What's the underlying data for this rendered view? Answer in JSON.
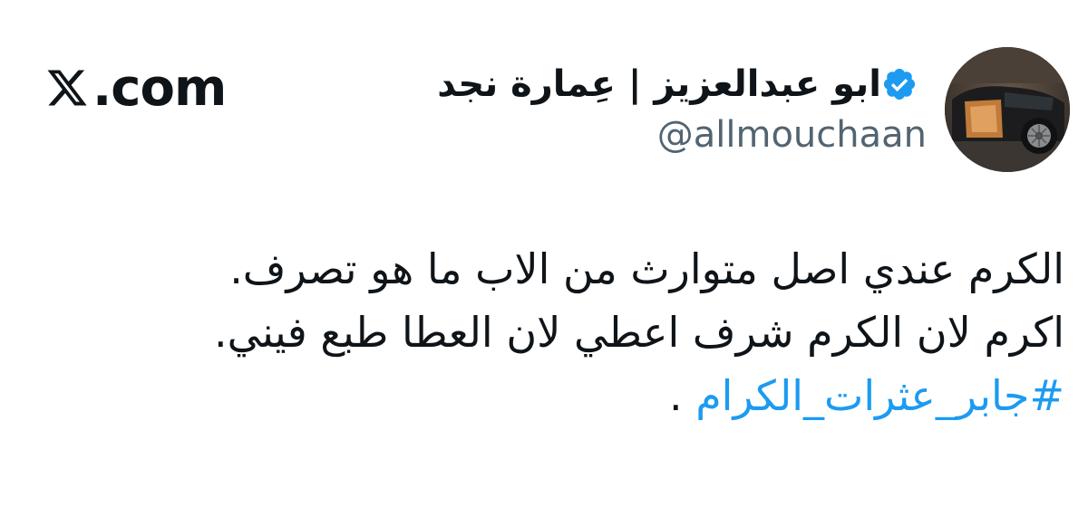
{
  "site": {
    "brand": ".com",
    "logo_icon": "x-logo-icon"
  },
  "author": {
    "display_name": "ابو عبدالعزيز | عِمارة نجد",
    "handle": "@allmouchaan",
    "verified": true,
    "badge_color": "#1d9bf0",
    "avatar_icon": "avatar-car-photo"
  },
  "tweet": {
    "lines": [
      "الكرم عندي اصل متوارث من الاب ما هو تصرف.",
      "اكرم لان الكرم شرف اعطي لان العطا طبع فيني."
    ],
    "hashtag": "#جابر_عثرات_الكرام",
    "trailing": " .",
    "hashtag_color": "#1d9bf0"
  }
}
